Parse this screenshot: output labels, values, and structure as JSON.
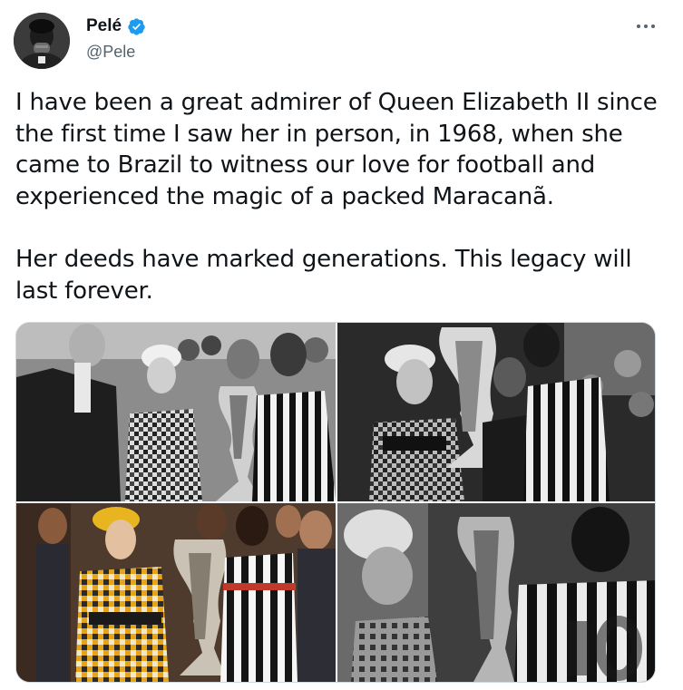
{
  "author": {
    "display_name": "Pelé",
    "handle": "@Pele",
    "verified": true,
    "avatar_icon": "avatar-photo"
  },
  "menu": {
    "icon": "more-dots-icon"
  },
  "tweet": {
    "paragraphs": [
      "I have been a great admirer of Queen Elizabeth II since the first time I saw her in person, in 1968, when she came to Brazil to witness our love for football and experienced the magic of a packed Maracanã.",
      "Her deeds have marked generations. This legacy will last forever."
    ]
  },
  "media": {
    "photos": [
      {
        "icon": "photo-1-bw-trophy-ceremony"
      },
      {
        "icon": "photo-2-bw-queen-holding-trophy"
      },
      {
        "icon": "photo-3-color-queen-yellow-dress"
      },
      {
        "icon": "photo-4-bw-closeup-number-10"
      }
    ]
  },
  "colors": {
    "verified_blue": "#1d9bf0",
    "handle_gray": "#536471",
    "text": "#0f1419",
    "border": "#cfd9de"
  }
}
